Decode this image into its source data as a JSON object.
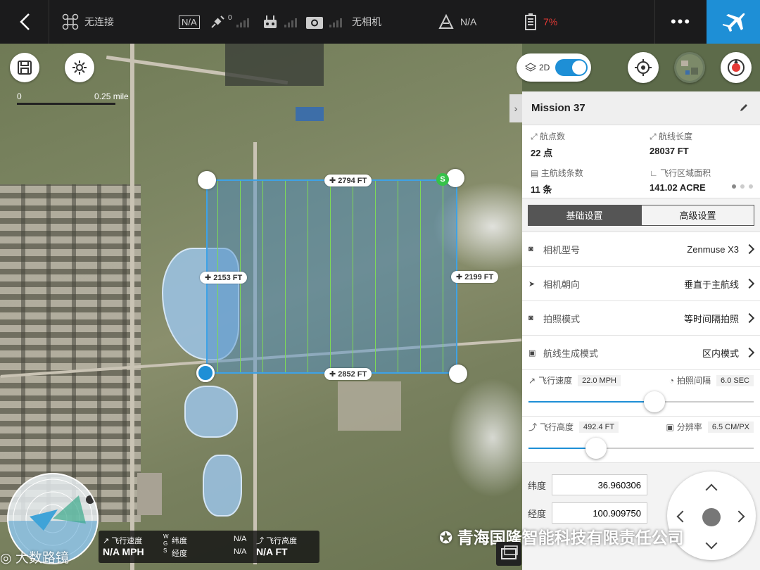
{
  "topbar": {
    "connection": "无连接",
    "gps": "N/A",
    "satellite_count": "0",
    "camera": "无相机",
    "mode": "N/A",
    "battery": "7%",
    "more": "•••"
  },
  "map": {
    "scale_left": "0",
    "scale_right": "0.25 mile",
    "toggle_label": "2D",
    "dim_top": "✚ 2794 FT",
    "dim_bottom": "✚ 2852 FT",
    "dim_left": "✚ 2153 FT",
    "dim_right": "✚ 2199 FT",
    "start_marker": "S"
  },
  "panel": {
    "title": "Mission 37",
    "stats": [
      {
        "label": "航点数",
        "value": "22 点"
      },
      {
        "label": "航线长度",
        "value": "28037 FT"
      },
      {
        "label": "主航线条数",
        "value": "11 条"
      },
      {
        "label": "飞行区域面积",
        "value": "141.02 ACRE"
      }
    ],
    "tabs": [
      "基础设置",
      "高级设置"
    ],
    "rows": [
      {
        "label": "相机型号",
        "value": "Zenmuse X3"
      },
      {
        "label": "相机朝向",
        "value": "垂直于主航线"
      },
      {
        "label": "拍照模式",
        "value": "等时间隔拍照"
      },
      {
        "label": "航线生成模式",
        "value": "区内模式"
      }
    ],
    "speed": {
      "label": "飞行速度",
      "value": "22.0 MPH",
      "interval_label": "拍照间隔",
      "interval_value": "6.0 SEC",
      "fraction": 0.56
    },
    "altitude": {
      "label": "飞行高度",
      "value": "492.4 FT",
      "res_label": "分辨率",
      "res_value": "6.5 CM/PX",
      "fraction": 0.3
    }
  },
  "coords": {
    "lat_label": "纬度",
    "lat_value": "36.960306",
    "lon_label": "经度",
    "lon_value": "100.909750"
  },
  "telemetry": {
    "speed_label": "飞行速度",
    "speed_value": "N/A MPH",
    "gps_w": "W",
    "gps_g": "G",
    "gps_s": "S",
    "lat_label": "纬度",
    "lon_label": "经度",
    "lat_value": "N/A",
    "lon_value": "N/A",
    "alt_label": "飞行高度",
    "alt_value": "N/A FT"
  },
  "watermark": "青海国隆智能科技有限责任公司",
  "watermark2": "大数路镜",
  "colors": {
    "accent": "#1e8fd6",
    "battery": "#e53935",
    "route": "#7ed957"
  }
}
